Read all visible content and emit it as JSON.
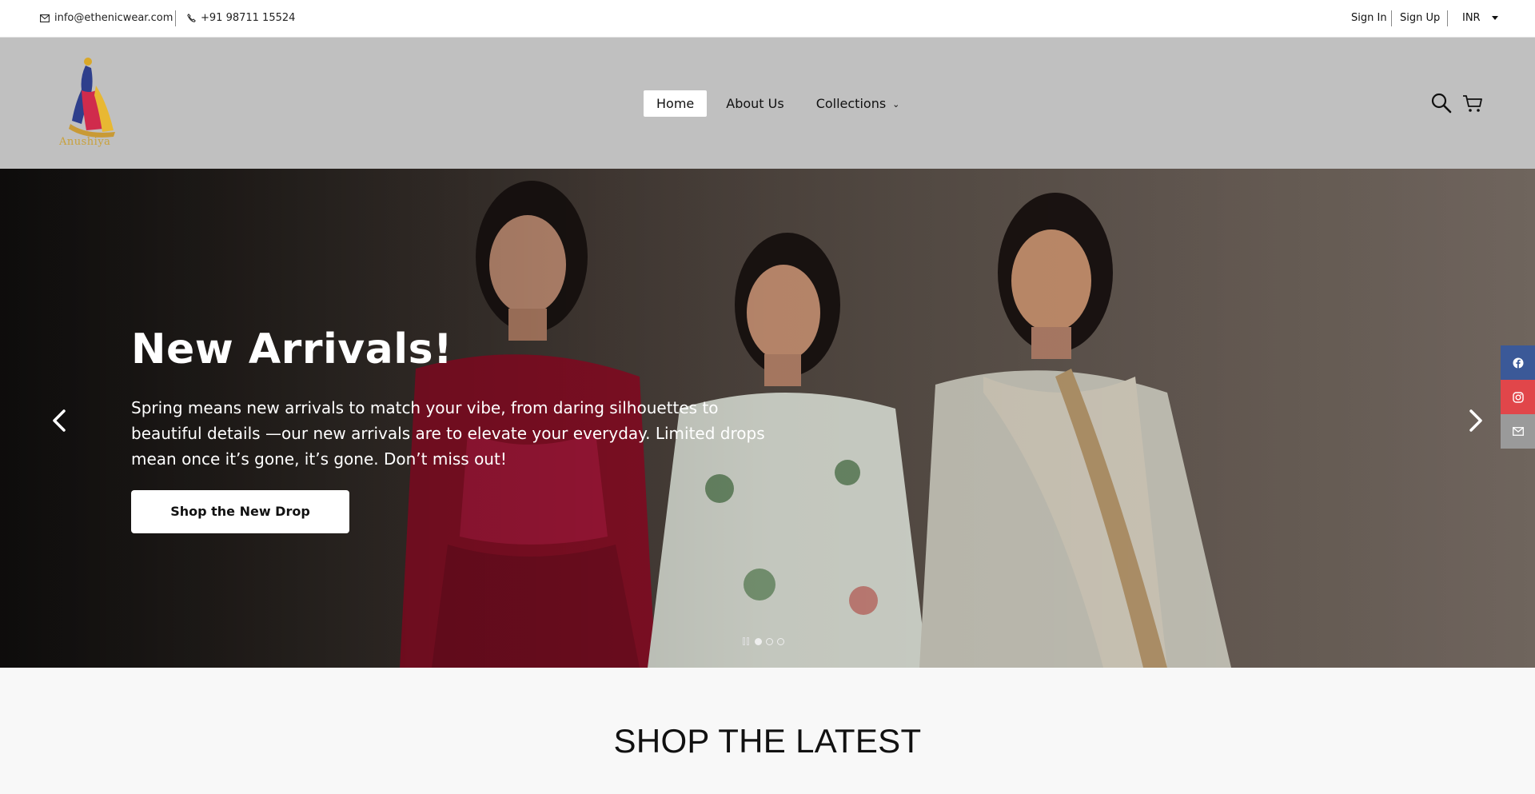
{
  "topbar": {
    "email": "info@ethenicwear.com",
    "phone": "+91 98711 15524",
    "sign_in": "Sign In",
    "sign_up": "Sign Up",
    "currency": "INR"
  },
  "header": {
    "logo_text": "Anushiya",
    "nav": [
      {
        "label": "Home",
        "active": true
      },
      {
        "label": "About Us",
        "active": false
      },
      {
        "label": "Collections",
        "active": false
      }
    ],
    "icons": [
      "search-icon",
      "cart-icon"
    ]
  },
  "hero": {
    "title": "New Arrivals!",
    "text": "Spring means new arrivals to match your vibe, from daring silhouettes to beautiful details —our new arrivals are to elevate your everyday. Limited drops mean once it’s gone, it’s gone. Don’t miss out!",
    "button": "Shop the New Drop",
    "slides": 3,
    "active_slide": 1
  },
  "social": [
    {
      "name": "facebook-icon",
      "color": "#3b5998"
    },
    {
      "name": "instagram-icon",
      "color": "#e1464a"
    },
    {
      "name": "mail-icon",
      "color": "#9a9a9a"
    }
  ],
  "section": {
    "title": "SHOP THE LATEST"
  }
}
